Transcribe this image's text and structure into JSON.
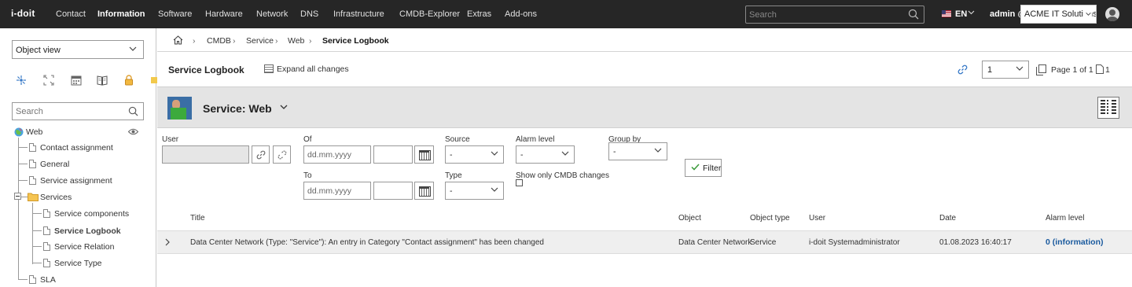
{
  "topbar": {
    "logo": "i-doit",
    "nav": [
      "Contact",
      "Information",
      "Software",
      "Hardware",
      "Network",
      "DNS",
      "Infrastructure",
      "CMDB-Explorer",
      "Extras",
      "Add-ons"
    ],
    "active_nav": "Information",
    "search_placeholder": "Search",
    "language": "EN",
    "user": "admin @",
    "tenant": "ACME IT Solutions"
  },
  "sidebar": {
    "view_select": "Object view",
    "search_placeholder": "Search",
    "icons": [
      "cmdb-explorer-icon",
      "fullscreen-icon",
      "calendar-icon",
      "book-icon",
      "lock-icon"
    ],
    "tree": {
      "root": "Web",
      "items": [
        {
          "label": "Contact assignment"
        },
        {
          "label": "General"
        },
        {
          "label": "Service assignment"
        },
        {
          "label": "Services",
          "folder": true
        },
        {
          "label": "Service components"
        },
        {
          "label": "Service Logbook",
          "selected": true
        },
        {
          "label": "Service Relation"
        },
        {
          "label": "Service Type"
        },
        {
          "label": "SLA"
        }
      ]
    }
  },
  "breadcrumb": [
    "CMDB",
    "Service",
    "Web",
    "Service Logbook"
  ],
  "titlebar": {
    "title": "Service Logbook",
    "expand_label": "Expand all changes",
    "page_select": "1",
    "page_of": "Page 1 of 1",
    "page_count": "1"
  },
  "object": {
    "title": "Service: Web"
  },
  "filters": {
    "user_label": "User",
    "of_label": "Of",
    "to_label": "To",
    "date_placeholder": "dd.mm.yyyy",
    "source_label": "Source",
    "source_value": "-",
    "type_label": "Type",
    "type_value": "-",
    "alarm_label": "Alarm level",
    "alarm_value": "-",
    "cmdb_only_label": "Show only CMDB changes",
    "group_label": "Group by",
    "group_value": "-",
    "filter_button": "Filter"
  },
  "table": {
    "headers": [
      "Title",
      "Object",
      "Object type",
      "User",
      "Date",
      "Alarm level"
    ],
    "rows": [
      {
        "title": "Data Center Network (Type: \"Service\"): An entry in Category \"Contact assignment\" has been changed",
        "object": "Data Center Network",
        "object_type": "Service",
        "user": "i-doit Systemadministrator",
        "date": "01.08.2023 16:40:17",
        "alarm_level": "0 (information)"
      }
    ]
  },
  "colors": {
    "topbar": "#262626",
    "object_header": "#e4e4e4",
    "alarm_link": "#1a5a9e",
    "link_icon": "#3a7bc8"
  }
}
